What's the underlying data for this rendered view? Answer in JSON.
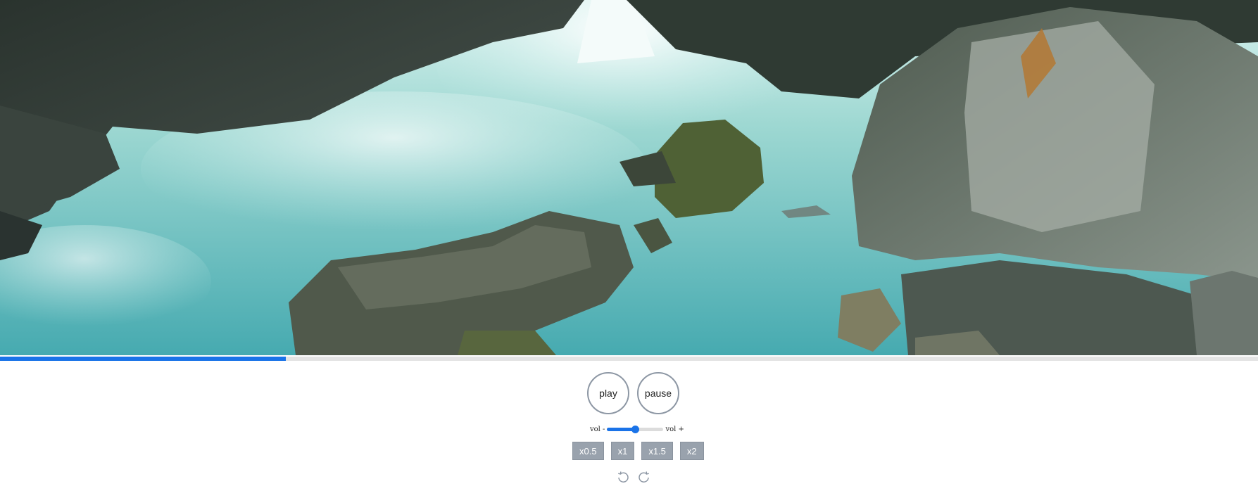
{
  "player": {
    "progress_fraction": 0.227,
    "controls": {
      "play_label": "play",
      "pause_label": "pause"
    },
    "volume": {
      "minus_label": "vol -",
      "plus_label": "vol +",
      "level_fraction": 0.5
    },
    "speed_options": [
      "x0.5",
      "x1",
      "x1.5",
      "x2"
    ],
    "seek": {
      "back_icon": "rewind-icon",
      "forward_icon": "forward-icon"
    },
    "colors": {
      "accent": "#1a73e8",
      "speed_button_bg": "#99a2ad"
    }
  }
}
